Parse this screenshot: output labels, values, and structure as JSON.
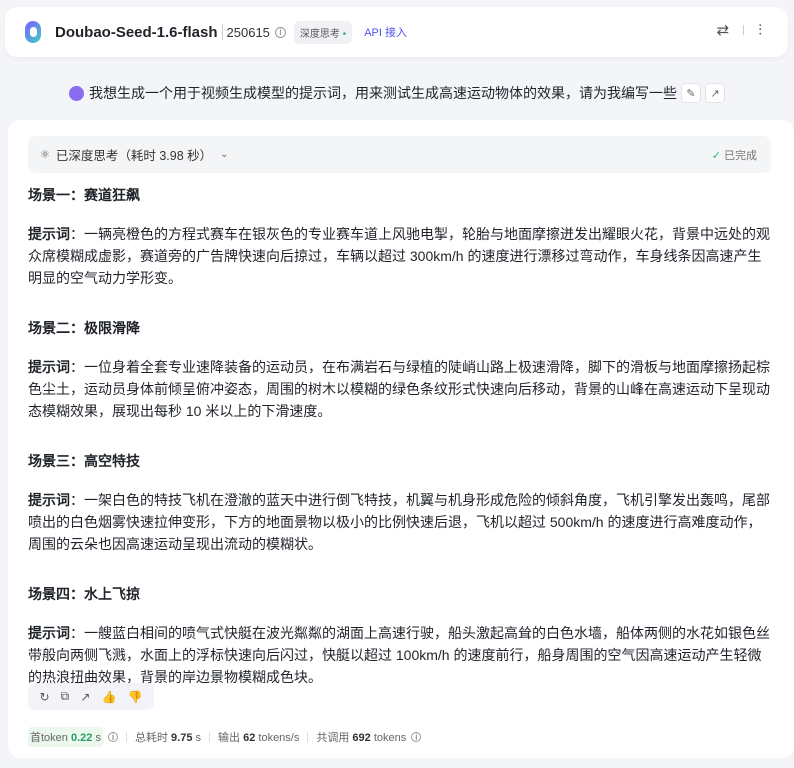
{
  "header": {
    "model": "Doubao-Seed-1.6-flash",
    "version": "250615",
    "tag": "深度思考",
    "api": "API 接入"
  },
  "question": "我想生成一个用于视频生成模型的提示词，用来测试生成高速运动物体的效果，请为我编写一些",
  "thinking": {
    "label": "已深度思考（耗时 3.98 秒）",
    "status": "已完成"
  },
  "scenes": [
    {
      "title": "场景一：赛道狂飙",
      "label": "提示词",
      "text": "：一辆亮橙色的方程式赛车在银灰色的专业赛车道上风驰电掣，轮胎与地面摩擦迸发出耀眼火花，背景中远处的观众席模糊成虚影，赛道旁的广告牌快速向后掠过，车辆以超过 300km/h 的速度进行漂移过弯动作，车身线条因高速产生明显的空气动力学形变。"
    },
    {
      "title": "场景二：极限滑降",
      "label": "提示词",
      "text": "：一位身着全套专业速降装备的运动员，在布满岩石与绿植的陡峭山路上极速滑降，脚下的滑板与地面摩擦扬起棕色尘土，运动员身体前倾呈俯冲姿态，周围的树木以模糊的绿色条纹形式快速向后移动，背景的山峰在高速运动下呈现动态模糊效果，展现出每秒 10 米以上的下滑速度。"
    },
    {
      "title": "场景三：高空特技",
      "label": "提示词",
      "text": "：一架白色的特技飞机在澄澈的蓝天中进行倒飞特技，机翼与机身形成危险的倾斜角度，飞机引擎发出轰鸣，尾部喷出的白色烟雾快速拉伸变形，下方的地面景物以极小的比例快速后退，飞机以超过 500km/h 的速度进行高难度动作，周围的云朵也因高速运动呈现出流动的模糊状。"
    },
    {
      "title": "场景四：水上飞掠",
      "label": "提示词",
      "text": "：一艘蓝白相间的喷气式快艇在波光粼粼的湖面上高速行驶，船头激起高耸的白色水墙，船体两侧的水花如银色丝带般向两侧飞溅，水面上的浮标快速向后闪过，快艇以超过 100km/h 的速度前行，船身周围的空气因高速运动产生轻微的热浪扭曲效果，背景的岸边景物模糊成色块。"
    }
  ],
  "stats": {
    "first_label": "首token",
    "first_val": "0.22",
    "first_unit": "s",
    "total_label": "总耗时",
    "total_val": "9.75",
    "total_unit": "s",
    "out_label": "输出",
    "out_val": "62",
    "out_unit": "tokens/s",
    "calls_label": "共调用",
    "calls_val": "692",
    "calls_unit": "tokens"
  }
}
